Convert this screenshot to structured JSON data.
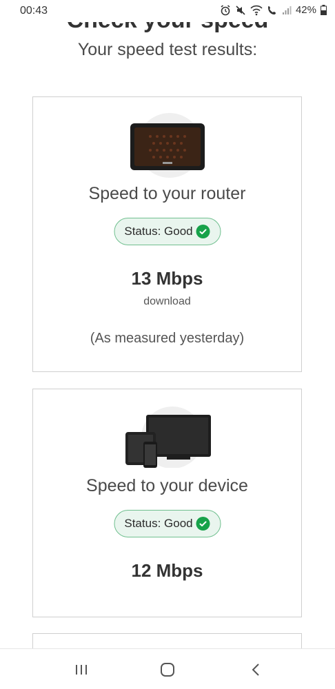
{
  "status_bar": {
    "time": "00:43",
    "battery": "42%",
    "icons": [
      "alarm-icon",
      "mute-icon",
      "wifi-icon",
      "wifi-calling-icon",
      "signal-icon",
      "battery-icon"
    ]
  },
  "page": {
    "title": "Check your speed",
    "subtitle": "Your speed test results:"
  },
  "cards": [
    {
      "heading": "Speed to your router",
      "status": "Status: Good",
      "speed": "13 Mbps",
      "speed_label": "download",
      "note": "(As measured yesterday)"
    },
    {
      "heading": "Speed to your device",
      "status": "Status: Good",
      "speed": "12 Mbps"
    }
  ],
  "colors": {
    "status_green": "#17a24a",
    "badge_bg": "#e9f5ee",
    "badge_border": "#6fbf8e"
  },
  "nav_bar": {
    "buttons": [
      "recent-apps",
      "home",
      "back"
    ]
  }
}
